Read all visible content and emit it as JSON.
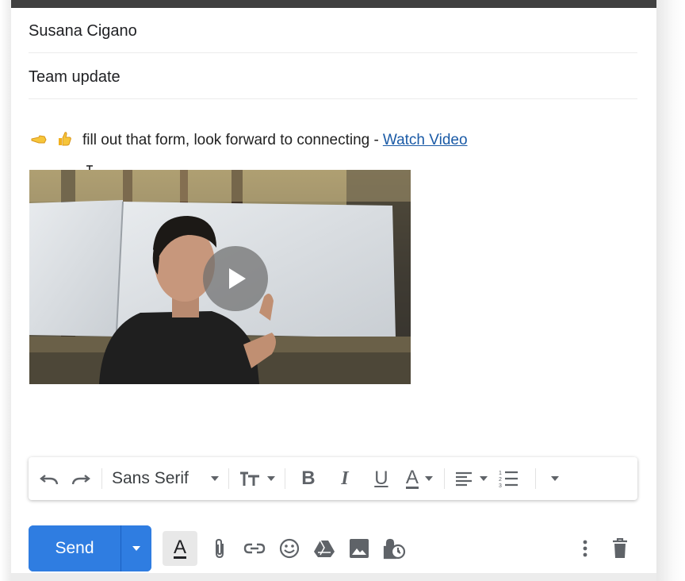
{
  "compose": {
    "to": "Susana Cigano",
    "subject": "Team update",
    "body": {
      "emoji_1": "point-left-emoji",
      "emoji_2": "thumbs-up-emoji",
      "text": "fill out that form, look forward to connecting -",
      "link_text": "Watch Video"
    }
  },
  "toolbar": {
    "font_name": "Sans Serif",
    "icons": [
      "undo-icon",
      "redo-icon",
      "text-size-icon",
      "bold-icon",
      "italic-icon",
      "underline-icon",
      "text-color-icon",
      "align-icon",
      "numbered-list-icon",
      "more-formatting-icon"
    ],
    "bold_glyph": "B",
    "italic_glyph": "I",
    "underline_glyph": "U",
    "color_glyph": "A"
  },
  "bottom": {
    "send_label": "Send",
    "format_glyph": "A",
    "icons": [
      "formatting-options-icon",
      "attach-icon",
      "link-icon",
      "emoji-icon",
      "drive-icon",
      "photo-icon",
      "confidential-mode-icon",
      "more-options-icon",
      "trash-icon"
    ]
  },
  "colors": {
    "accent": "#1a73e8",
    "link": "#1a5aa6"
  }
}
